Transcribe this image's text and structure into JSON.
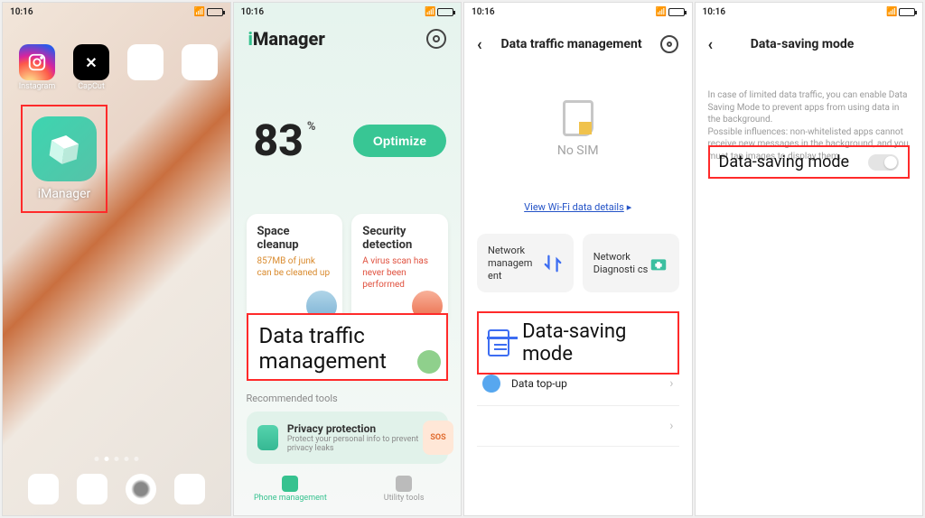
{
  "status": {
    "time": "10:16",
    "battery_pct": 17
  },
  "home": {
    "apps": [
      {
        "name": "Instagram"
      },
      {
        "name": "CapCut"
      }
    ],
    "highlight_app": "iManager"
  },
  "imanager": {
    "brand_prefix": "i",
    "brand_rest": "Manager",
    "score": "83",
    "score_unit": "%",
    "optimize_label": "Optimize",
    "card_space": {
      "title": "Space cleanup",
      "sub": "857MB of junk can be cleaned up"
    },
    "card_security": {
      "title": "Security detection",
      "sub": "A virus scan has never been performed"
    },
    "data_traffic_title": "Data traffic management",
    "recommended_label": "Recommended tools",
    "privacy": {
      "title": "Privacy protection",
      "sub": "Protect your personal info to prevent privacy leaks"
    },
    "sos": "SOS",
    "nav": {
      "pm": "Phone management",
      "ut": "Utility tools"
    }
  },
  "dtm": {
    "title": "Data traffic management",
    "sim_label": "No SIM",
    "wifi_link": "View Wi-Fi data details",
    "net_mgmt": "Network managem ent",
    "net_diag": "Network Diagnosti cs",
    "dsm_label": "Data-saving mode",
    "topup_label": "Data top-up"
  },
  "dsm": {
    "title": "Data-saving mode",
    "desc": "In case of limited data traffic, you can enable Data Saving Mode to prevent apps from using data in the background.\nPossible influences: non-whitelisted apps cannot receive new messages in the background, and you must tap images to display them.",
    "toggle_label": "Data-saving mode",
    "toggle_on": false
  }
}
